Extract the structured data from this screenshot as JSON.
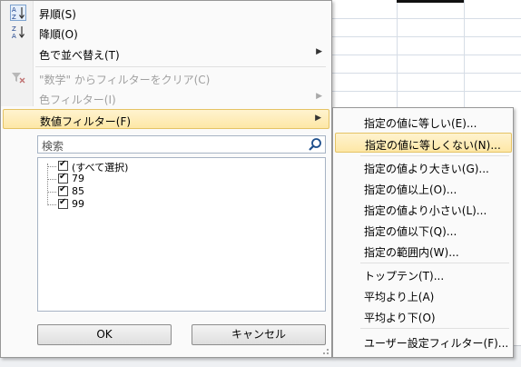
{
  "menu": {
    "items": [
      {
        "label": "昇順(S)",
        "icon": "sort-ascending-icon"
      },
      {
        "label": "降順(O)",
        "icon": "sort-descending-icon"
      },
      {
        "label": "色で並べ替え(T)"
      },
      {
        "label": "\"数学\" からフィルターをクリア(C)",
        "icon": "clear-filter-icon"
      },
      {
        "label": "色フィルター(I)"
      },
      {
        "label": "数値フィルター(F)"
      }
    ],
    "search_placeholder": "検索",
    "tree_items": [
      "(すべて選択)",
      "79",
      "85",
      "99"
    ],
    "ok_label": "OK",
    "cancel_label": "キャンセル"
  },
  "submenu": {
    "items": [
      "指定の値に等しい(E)...",
      "指定の値に等しくない(N)...",
      "指定の値より大きい(G)...",
      "指定の値以上(O)...",
      "指定の値より小さい(L)...",
      "指定の値以下(Q)...",
      "指定の範囲内(W)...",
      "トップテン(T)...",
      "平均より上(A)",
      "平均より下(O)",
      "ユーザー設定フィルター(F)..."
    ]
  },
  "colors": {
    "highlight": "#fde7a6",
    "highlight_border": "#e5c365",
    "menu_bg": "#fafafa",
    "border": "#979797"
  }
}
